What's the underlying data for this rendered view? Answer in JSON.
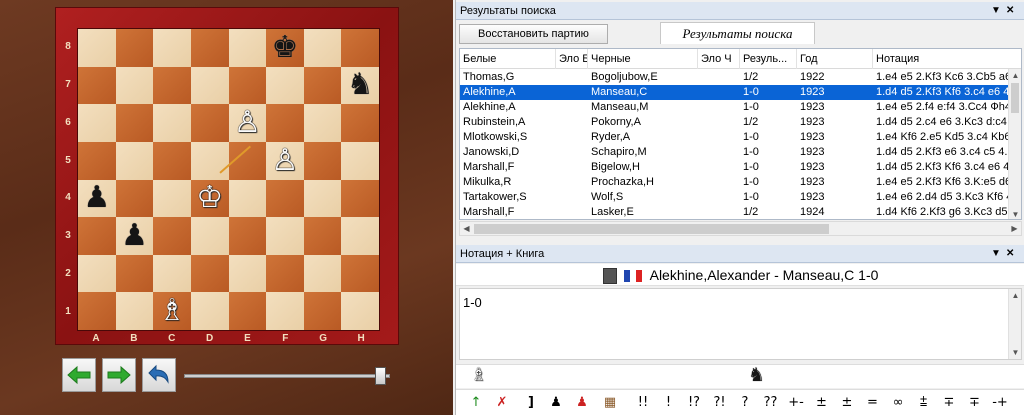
{
  "board": {
    "ranks": [
      "8",
      "7",
      "6",
      "5",
      "4",
      "3",
      "2",
      "1"
    ],
    "files": [
      "A",
      "B",
      "C",
      "D",
      "E",
      "F",
      "G",
      "H"
    ],
    "pieces": [
      {
        "sq": "f8",
        "glyph": "♚",
        "color": "black",
        "name": "black-king"
      },
      {
        "sq": "h7",
        "glyph": "♞",
        "color": "black",
        "name": "black-knight"
      },
      {
        "sq": "e6",
        "glyph": "♙",
        "color": "white",
        "name": "white-pawn"
      },
      {
        "sq": "f5",
        "glyph": "♙",
        "color": "white",
        "name": "white-pawn"
      },
      {
        "sq": "a4",
        "glyph": "♟",
        "color": "black",
        "name": "black-pawn"
      },
      {
        "sq": "d4",
        "glyph": "♔",
        "color": "white",
        "name": "white-king"
      },
      {
        "sq": "b3",
        "glyph": "♟",
        "color": "black",
        "name": "black-pawn"
      },
      {
        "sq": "c1",
        "glyph": "♗",
        "color": "white",
        "name": "white-bishop"
      }
    ]
  },
  "search_panel": {
    "title": "Результаты поиска",
    "restore_button": "Восстановить партию",
    "tab_label": "Результаты поиска",
    "columns": [
      "Белые",
      "Эло Б",
      "Черные",
      "Эло Ч",
      "Резуль...",
      "Год",
      "Нотация"
    ],
    "rows": [
      {
        "white": "Thomas,G",
        "elo_w": "",
        "black": "Bogoljubow,E",
        "elo_b": "",
        "result": "1/2",
        "year": "1922",
        "notation": "1.e4 e5 2.Kf3 Kc6 3.Cb5 a6"
      },
      {
        "white": "Alekhine,A",
        "elo_w": "",
        "black": "Manseau,C",
        "elo_b": "",
        "result": "1-0",
        "year": "1923",
        "notation": "1.d4 d5 2.Kf3 Kf6 3.c4 e6 4",
        "selected": true
      },
      {
        "white": "Alekhine,A",
        "elo_w": "",
        "black": "Manseau,M",
        "elo_b": "",
        "result": "1-0",
        "year": "1923",
        "notation": "1.e4 e5 2.f4 e:f4 3.Cc4 Фh4"
      },
      {
        "white": "Rubinstein,A",
        "elo_w": "",
        "black": "Pokorny,A",
        "elo_b": "",
        "result": "1/2",
        "year": "1923",
        "notation": "1.d4 d5 2.c4 e6 3.Kc3 d:c4"
      },
      {
        "white": "Mlotkowski,S",
        "elo_w": "",
        "black": "Ryder,A",
        "elo_b": "",
        "result": "1-0",
        "year": "1923",
        "notation": "1.e4 Kf6 2.e5 Kd5 3.c4 Kb6"
      },
      {
        "white": "Janowski,D",
        "elo_w": "",
        "black": "Schapiro,M",
        "elo_b": "",
        "result": "1-0",
        "year": "1923",
        "notation": "1.d4 d5 2.Kf3 e6 3.c4 c5 4."
      },
      {
        "white": "Marshall,F",
        "elo_w": "",
        "black": "Bigelow,H",
        "elo_b": "",
        "result": "1-0",
        "year": "1923",
        "notation": "1.d4 d5 2.Kf3 Kf6 3.c4 e6 4"
      },
      {
        "white": "Mikulka,R",
        "elo_w": "",
        "black": "Prochazka,H",
        "elo_b": "",
        "result": "1-0",
        "year": "1923",
        "notation": "1.e4 e5 2.Kf3 Kf6 3.K:e5 d6"
      },
      {
        "white": "Tartakower,S",
        "elo_w": "",
        "black": "Wolf,S",
        "elo_b": "",
        "result": "1-0",
        "year": "1923",
        "notation": "1.e4 e6 2.d4 d5 3.Kc3 Kf6 4"
      },
      {
        "white": "Marshall,F",
        "elo_w": "",
        "black": "Lasker,E",
        "elo_b": "",
        "result": "1/2",
        "year": "1924",
        "notation": "1.d4 Kf6 2.Kf3 g6 3.Kc3 d5"
      }
    ]
  },
  "notation_panel": {
    "title": "Нотация + Книга",
    "game_title": "Alekhine,Alexander - Manseau,C  1-0",
    "text": "1-0"
  },
  "annotation_symbols": [
    "!!",
    "!",
    "!?",
    "?!",
    "?",
    "??",
    "+-",
    "±",
    "±",
    "=",
    "∞",
    "⩲",
    "∓",
    "∓",
    "-+"
  ],
  "colors": {
    "selection": "#0a64d6",
    "panel_title": "#dde6f2",
    "board_dark": "#c7682e",
    "board_light": "#efd8b4",
    "frame": "#b02020",
    "nav_green": "#2faa2f",
    "nav_blue": "#2a6db5"
  }
}
